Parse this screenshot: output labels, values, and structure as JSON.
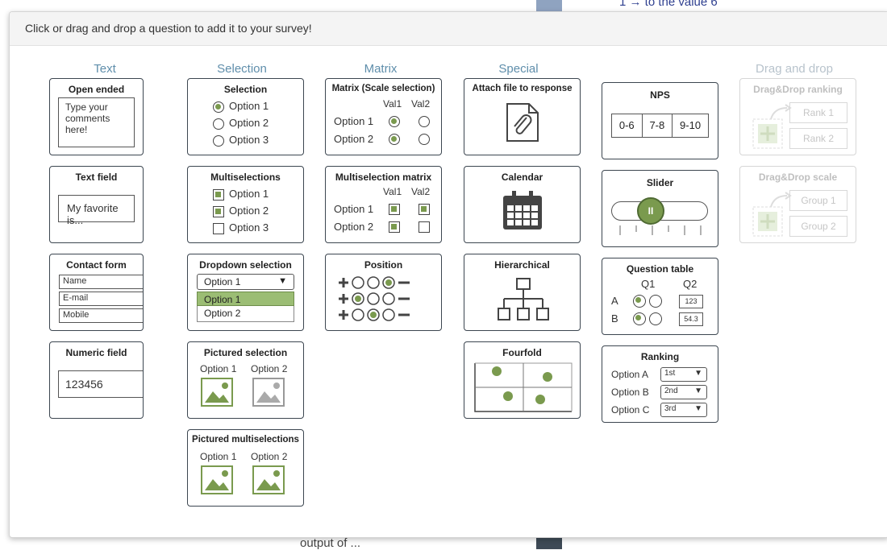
{
  "background": {
    "top_text": "1 → to the value 6",
    "bottom_text": "output of ..."
  },
  "header": {
    "text": "Click or drag and drop a question to add it to your survey!"
  },
  "columns": {
    "text": "Text",
    "selection": "Selection",
    "matrix": "Matrix",
    "special": "Special",
    "dragdrop": "Drag and drop"
  },
  "cards": {
    "open_ended": {
      "title": "Open ended",
      "placeholder": "Type your comments here!"
    },
    "text_field": {
      "title": "Text field",
      "value": "My favorite is..."
    },
    "contact_form": {
      "title": "Contact form",
      "fields": [
        "Name",
        "E-mail",
        "Mobile"
      ]
    },
    "numeric_field": {
      "title": "Numeric field",
      "value": "123456"
    },
    "selection": {
      "title": "Selection",
      "options": [
        "Option 1",
        "Option 2",
        "Option 3"
      ]
    },
    "multiselections": {
      "title": "Multiselections",
      "options": [
        "Option 1",
        "Option 2",
        "Option 3"
      ]
    },
    "dropdown": {
      "title": "Dropdown selection",
      "selected": "Option 1",
      "options": [
        "Option 1",
        "Option 2"
      ],
      "arrow": "▼"
    },
    "pictured_selection": {
      "title": "Pictured selection",
      "options": [
        "Option 1",
        "Option 2"
      ]
    },
    "pictured_multi": {
      "title": "Pictured multiselections",
      "options": [
        "Option 1",
        "Option 2"
      ]
    },
    "matrix_scale": {
      "title": "Matrix (Scale selection)",
      "cols": [
        "Val1",
        "Val2"
      ],
      "rows": [
        "Option 1",
        "Option 2"
      ]
    },
    "multi_matrix": {
      "title": "Multiselection matrix",
      "cols": [
        "Val1",
        "Val2"
      ],
      "rows": [
        "Option 1",
        "Option 2"
      ]
    },
    "position": {
      "title": "Position"
    },
    "attach": {
      "title": "Attach file to response"
    },
    "calendar": {
      "title": "Calendar"
    },
    "hierarchical": {
      "title": "Hierarchical"
    },
    "fourfold": {
      "title": "Fourfold"
    },
    "nps": {
      "title": "NPS",
      "segments": [
        "0-6",
        "7-8",
        "9-10"
      ]
    },
    "slider": {
      "title": "Slider",
      "handle": "II"
    },
    "question_table": {
      "title": "Question table",
      "cols": [
        "Q1",
        "Q2"
      ],
      "rows": [
        "A",
        "B"
      ],
      "values": [
        "123",
        "54.3"
      ]
    },
    "ranking": {
      "title": "Ranking",
      "rows": [
        "Option A",
        "Option B",
        "Option C"
      ],
      "ranks": [
        "1st",
        "2nd",
        "3rd"
      ],
      "arrow": "▼"
    },
    "dd_ranking": {
      "title": "Drag&Drop ranking",
      "items": [
        "Rank 1",
        "Rank 2"
      ]
    },
    "dd_scale": {
      "title": "Drag&Drop scale",
      "items": [
        "Group 1",
        "Group 2"
      ]
    }
  },
  "colors": {
    "accent": "#7a9a4e",
    "column_title": "#5f8eab",
    "border": "#3c4650",
    "disabled": "#c6c6c6"
  }
}
